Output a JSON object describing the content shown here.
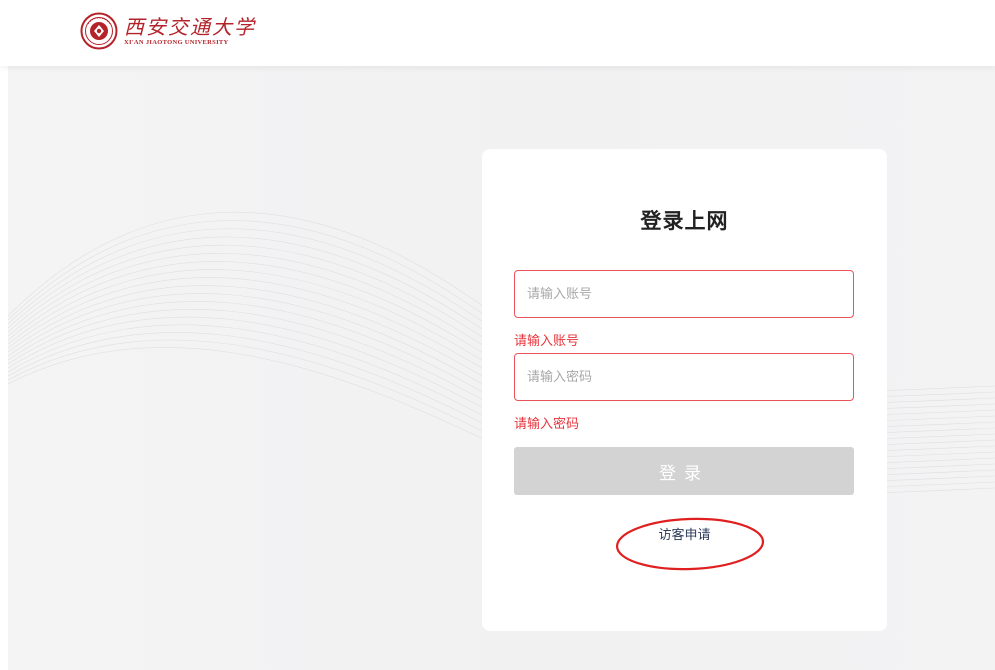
{
  "header": {
    "logo": {
      "cn_name": "西安交通大学",
      "en_name": "XI'AN JIAOTONG UNIVERSITY",
      "emblem_icon": "university-emblem-icon",
      "brand_color": "#b4232a"
    }
  },
  "login": {
    "title": "登录上网",
    "account": {
      "placeholder": "请输入账号",
      "value": "",
      "error": "请输入账号"
    },
    "password": {
      "placeholder": "请输入密码",
      "value": "",
      "error": "请输入密码"
    },
    "submit_label": "登录",
    "visitor_link": "访客申请",
    "error_color": "#e8343c",
    "button_disabled_color": "#d3d3d3"
  },
  "annotation": {
    "shape": "red-ellipse",
    "color": "#e02020"
  }
}
